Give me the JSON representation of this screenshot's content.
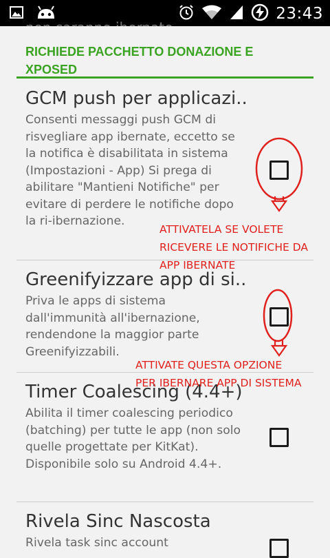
{
  "status_bar": {
    "time": "23:43",
    "left_icons": [
      "image-icon",
      "android-debug-icon"
    ],
    "right_icons": [
      "alarm-icon",
      "wifi-icon",
      "signal-icon",
      "battery-charging-icon"
    ]
  },
  "cut_off_text": "non saranno ibernate.",
  "section": {
    "header": "RICHIEDE PACCHETTO DONAZIONE E XPOSED",
    "color": "#3aa321"
  },
  "preferences": [
    {
      "title": "GCM push per applicazi..",
      "summary": "Consenti messaggi push GCM di risvegliare app ibernate, eccetto se la notifica è disabilitata in sistema (Impostazioni - App) Si prega di abilitare \"Mantieni Notifiche\" per evitare di perdere le notifiche dopo la ri-ibernazione.",
      "checked": false
    },
    {
      "title": "Greenifyizzare app di si..",
      "summary": "Priva le apps di sistema dall'immunità all'ibernazione, rendendone la maggior parte Greenifyizzabili.",
      "checked": false
    },
    {
      "title": "Timer Coalescing (4.4+)",
      "summary": "Abilita il timer coalescing periodico (batching) per tutte le app (non solo quelle progettate per KitKat). Disponibile solo su Android 4.4+.",
      "checked": false
    },
    {
      "title": "Rivela Sinc Nascosta",
      "summary": "Rivela task sinc account",
      "checked": false
    }
  ],
  "annotations": {
    "first": [
      "ATTIVATELA SE VOLETE",
      "RICEVERE LE NOTIFICHE DA",
      "APP IBERNATE"
    ],
    "second": [
      "ATTIVATE QUESTA OPZIONE",
      "PER IBERNARE APP DI SISTEMA"
    ],
    "color": "#e0201c"
  }
}
